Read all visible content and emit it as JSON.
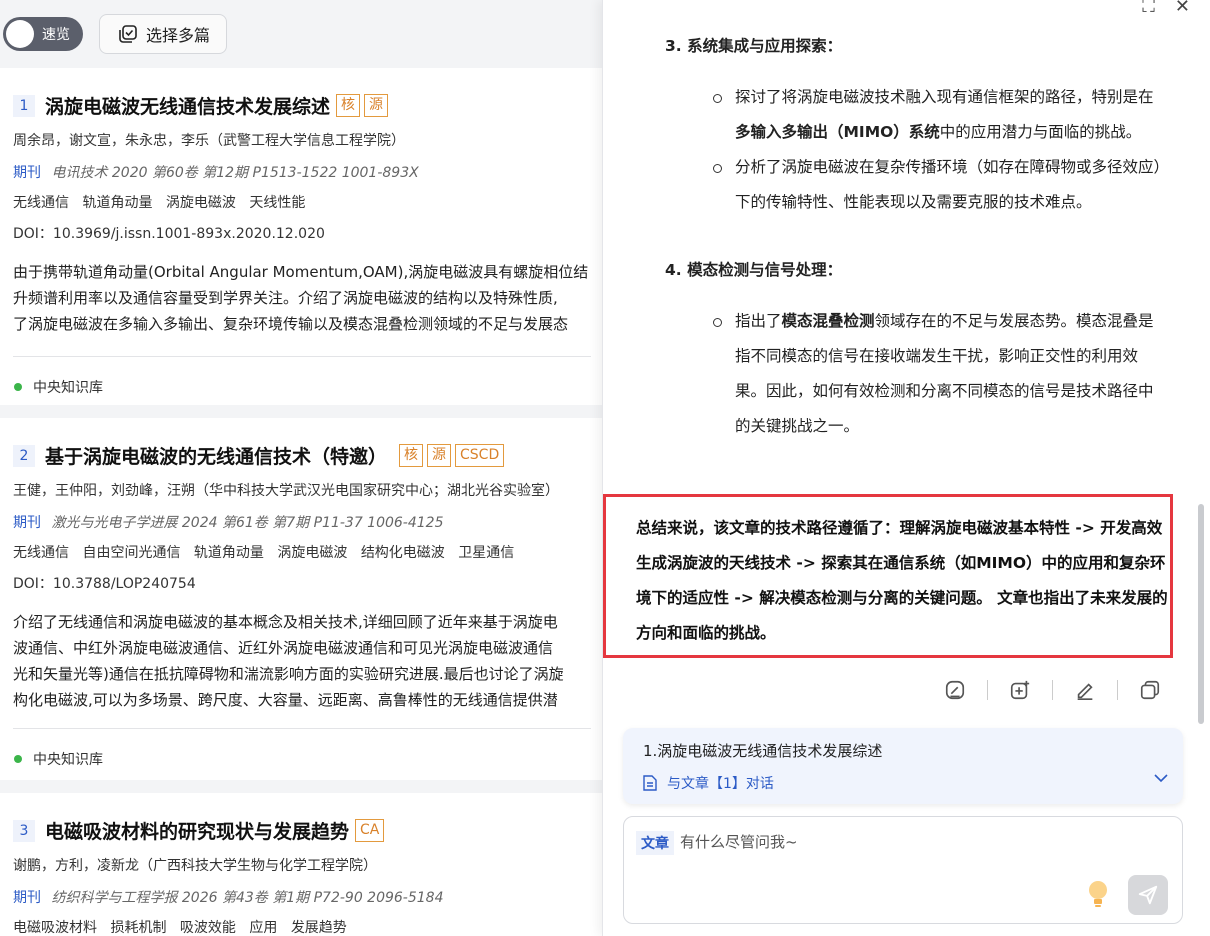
{
  "toolbar": {
    "speed_label": "速览",
    "multi_select_label": "选择多篇"
  },
  "results": [
    {
      "index": "1",
      "title": "涡旋电磁波无线通信技术发展综述",
      "tags": [
        "核",
        "源"
      ],
      "authors": "周余昂，谢文宣，朱永忠，李乐（武警工程大学信息工程学院）",
      "pub_type": "期刊",
      "pub_info": "电讯技术 2020 第60卷 第12期 P1513-1522 1001-893X",
      "keywords": [
        "无线通信",
        "轨道角动量",
        "涡旋电磁波",
        "天线性能"
      ],
      "doi": "DOI：10.3969/j.issn.1001-893x.2020.12.020",
      "abstract_lines": [
        "由于携带轨道角动量(Orbital Angular Momentum,OAM),涡旋电磁波具有螺旋相位结",
        "升频谱利用率以及通信容量受到学界关注。介绍了涡旋电磁波的结构以及特殊性质,",
        "了涡旋电磁波在多输入多输出、复杂环境传输以及模态混叠检测领域的不足与发展态"
      ],
      "kb": "中央知识库"
    },
    {
      "index": "2",
      "title": "基于涡旋电磁波的无线通信技术（特邀）",
      "tags": [
        "核",
        "源",
        "CSCD"
      ],
      "authors": "王健，王仲阳，刘劲峰，汪朔（华中科技大学武汉光电国家研究中心；湖北光谷实验室）",
      "pub_type": "期刊",
      "pub_info": "激光与光电子学进展 2024 第61卷 第7期 P11-37 1006-4125",
      "keywords": [
        "无线通信",
        "自由空间光通信",
        "轨道角动量",
        "涡旋电磁波",
        "结构化电磁波",
        "卫星通信"
      ],
      "doi": "DOI：10.3788/LOP240754",
      "abstract_lines": [
        "介绍了无线通信和涡旋电磁波的基本概念及相关技术,详细回顾了近年来基于涡旋电",
        "波通信、中红外涡旋电磁波通信、近红外涡旋电磁波通信和可见光涡旋电磁波通信",
        "光和矢量光等)通信在抵抗障碍物和湍流影响方面的实验研究进展.最后也讨论了涡旋",
        "构化电磁波,可以为多场景、跨尺度、大容量、远距离、高鲁棒性的无线通信提供潜"
      ],
      "kb": "中央知识库"
    },
    {
      "index": "3",
      "title": "电磁吸波材料的研究现状与发展趋势",
      "tags": [
        "CA"
      ],
      "authors": "谢鹏，方利，凌新龙（广西科技大学生物与化学工程学院）",
      "pub_type": "期刊",
      "pub_info": "纺织科学与工程学报 2026 第43卷 第1期 P72-90 2096-5184",
      "keywords": [
        "电磁吸波材料",
        "损耗机制",
        "吸波效能",
        "应用",
        "发展趋势"
      ]
    }
  ],
  "chat": {
    "section3_title": "3. 系统集成与应用探索：",
    "section3_b1_pre": "探讨了将涡旋电磁波技术融入现有通信框架的路径，特别是在",
    "section3_b1_bold": "多输入多输出（MIMO）系统",
    "section3_b1_post": "中的应用潜力与面临的挑战。",
    "section3_b2": "分析了涡旋电磁波在复杂传播环境（如存在障碍物或多径效应）下的传输特性、性能表现以及需要克服的技术难点。",
    "section4_title": "4. 模态检测与信号处理：",
    "section4_b1_pre": "指出了",
    "section4_b1_bold": "模态混叠检测",
    "section4_b1_post": "领域存在的不足与发展态势。模态混叠是指不同模态的信号在接收端发生干扰，影响正交性的利用效果。因此，如何有效检测和分离不同模态的信号是技术路径中的关键挑战之一。",
    "summary": "总结来说，该文章的技术路径遵循了：理解涡旋电磁波基本特性 -> 开发高效生成涡旋波的天线技术 -> 探索其在通信系统（如MIMO）中的应用和复杂环境下的适应性 -> 解决模态检测与分离的关键问题。 文章也指出了未来发展的方向和面临的挑战。"
  },
  "reference": {
    "title": "1.涡旋电磁波无线通信技术发展综述",
    "chat_label": "与文章【1】对话"
  },
  "input": {
    "scope_tag": "文章",
    "placeholder": "有什么尽管问我~"
  },
  "colors": {
    "accent": "#2c5bc6",
    "tag_orange": "#d9822b",
    "highlight_red": "#e5373f",
    "kb_green": "#3bb54a"
  }
}
